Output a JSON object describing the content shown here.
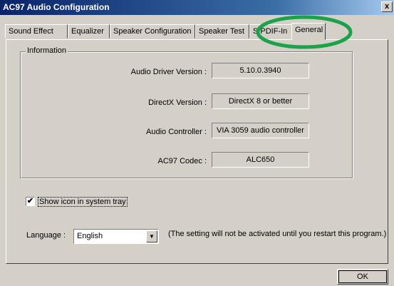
{
  "window": {
    "title": "AC97 Audio Configuration",
    "close_label": "x"
  },
  "tabs": [
    {
      "label": "Sound Effect"
    },
    {
      "label": "Equalizer"
    },
    {
      "label": "Speaker Configuration"
    },
    {
      "label": "Speaker Test"
    },
    {
      "label": "S/PDIF-In"
    },
    {
      "label": "General",
      "active": true
    }
  ],
  "info": {
    "legend": "Information",
    "driver_label": "Audio Driver Version :",
    "driver_value": "5.10.0.3940",
    "directx_label": "DirectX Version :",
    "directx_value": "DirectX 8 or better",
    "controller_label": "Audio Controller :",
    "controller_value": "VIA 3059 audio controller",
    "codec_label": "AC97 Codec :",
    "codec_value": "ALC650"
  },
  "tray": {
    "label": "Show icon in system tray",
    "checked": true,
    "check_glyph": "✔"
  },
  "language": {
    "label": "Language :",
    "selected": "English",
    "note": "(The setting will not be activated until you restart this program.)"
  },
  "buttons": {
    "ok": "OK"
  },
  "annotation": {
    "highlight_color": "#1aa34a"
  }
}
